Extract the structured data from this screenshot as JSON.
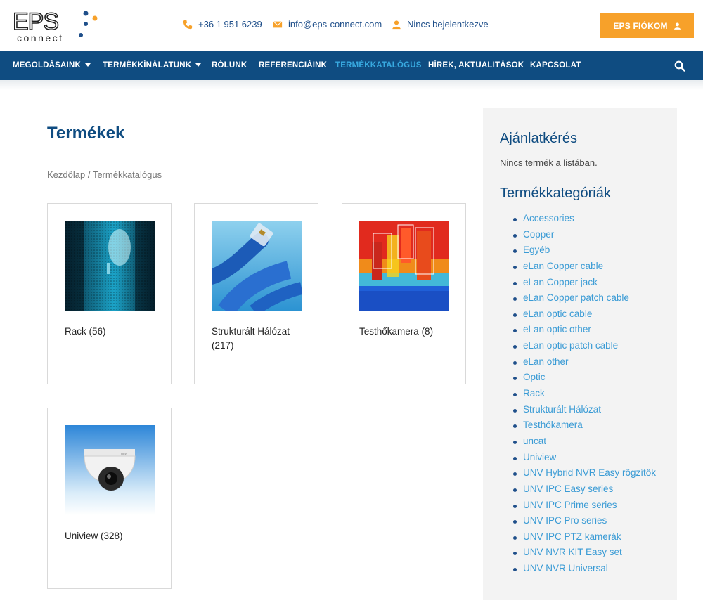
{
  "header": {
    "logo_text": "EPS connect",
    "phone": "+36 1 951 6239",
    "email": "info@eps-connect.com",
    "login_status": "Nincs bejelentkezve",
    "account_button": "EPS FIÓKOM"
  },
  "nav": {
    "items": [
      {
        "label": "MEGOLDÁSAINK",
        "has_dropdown": true
      },
      {
        "label": "TERMÉKKÍNÁLATUNK",
        "has_dropdown": true
      },
      {
        "label": "RÓLUNK",
        "has_dropdown": false
      },
      {
        "label": "REFERENCIÁINK",
        "has_dropdown": false
      },
      {
        "label": "TERMÉKKATALÓGUS",
        "has_dropdown": false,
        "active": true
      },
      {
        "label": "HÍREK, AKTUALITÁSOK",
        "has_dropdown": false
      },
      {
        "label": "KAPCSOLAT",
        "has_dropdown": false
      }
    ]
  },
  "main": {
    "title": "Termékek",
    "breadcrumb": {
      "home": "Kezdőlap",
      "separator": " / ",
      "current": "Termékkatalógus"
    },
    "categories": [
      {
        "name": "Rack",
        "count": "(56)"
      },
      {
        "name": "Strukturált Hálózat",
        "count": "(217)"
      },
      {
        "name": "Testhőkamera",
        "count": "(8)"
      },
      {
        "name": "Uniview",
        "count": "(328)"
      }
    ]
  },
  "sidebar": {
    "quote_title": "Ajánlatkérés",
    "quote_empty": "Nincs termék a listában.",
    "categories_title": "Termékkategóriák",
    "categories": [
      "Accessories",
      "Copper",
      "Egyéb",
      "eLan Copper cable",
      "eLan Copper jack",
      "eLan Copper patch cable",
      "eLan optic cable",
      "eLan optic other",
      "eLan optic patch cable",
      "eLan other",
      "Optic",
      "Rack",
      "Strukturált Hálózat",
      "Testhőkamera",
      "uncat",
      "Uniview",
      "UNV Hybrid NVR Easy rögzítők",
      "UNV IPC Easy series",
      "UNV IPC Prime series",
      "UNV IPC Pro series",
      "UNV IPC PTZ kamerák",
      "UNV NVR KIT Easy set",
      "UNV NVR Universal"
    ]
  },
  "colors": {
    "brand_blue": "#0f4c81",
    "accent_orange": "#f7a12a",
    "link_blue": "#3a9bd5"
  }
}
